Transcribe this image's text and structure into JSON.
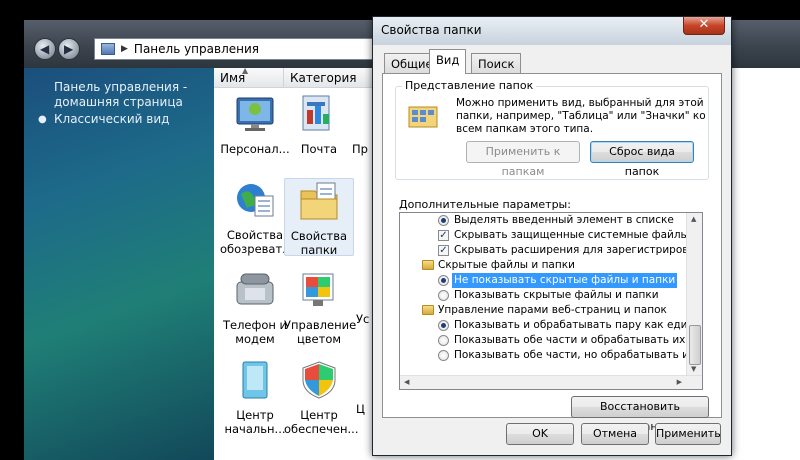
{
  "explorer": {
    "address": "Панель управления",
    "left_pane": {
      "home_link": "Панель управления - домашняя страница",
      "classic_link": "Классический вид"
    },
    "columns": [
      "Имя",
      "Категория"
    ],
    "items": [
      {
        "label": "Персонал...",
        "icon": "personalization-icon"
      },
      {
        "label": "Почта",
        "icon": "mail-icon"
      },
      {
        "label": "Пр",
        "icon": "partial-icon"
      },
      {
        "label": "Свойства обозреват...",
        "icon": "internet-options-icon"
      },
      {
        "label": "Свойства папки",
        "icon": "folder-options-icon"
      },
      {
        "label": "Телефон и модем",
        "icon": "phone-modem-icon"
      },
      {
        "label": "Управление цветом",
        "icon": "color-management-icon"
      },
      {
        "label": "Ус",
        "icon": "partial-icon"
      },
      {
        "label": "Центр начальн...",
        "icon": "welcome-center-icon"
      },
      {
        "label": "Центр обеспечен...",
        "icon": "security-center-icon"
      },
      {
        "label": "Ц",
        "icon": "partial-icon"
      }
    ]
  },
  "dialog": {
    "title": "Свойства папки",
    "close_label": "✕",
    "tabs": [
      "Общие",
      "Вид",
      "Поиск"
    ],
    "active_tab": "Вид",
    "folder_views": {
      "label": "Представление папок",
      "description": "Можно применить вид, выбранный для этой папки, например, \"Таблица\" или \"Значки\" ко всем папкам этого типа.",
      "apply_button": "Применить к папкам",
      "reset_button": "Сброс вида папок"
    },
    "advanced_label": "Дополнительные параметры:",
    "advanced_items": [
      {
        "type": "radio",
        "checked": true,
        "label": "Выделять введенный элемент в списке",
        "level": 1
      },
      {
        "type": "check",
        "checked": true,
        "label": "Скрывать защищенные системные файлы (рекомен",
        "level": 1
      },
      {
        "type": "check",
        "checked": true,
        "label": "Скрывать расширения для зарегистрированных типо",
        "level": 1
      },
      {
        "type": "folder",
        "label": "Скрытые файлы и папки",
        "level": 0
      },
      {
        "type": "radio",
        "checked": true,
        "label": "Не показывать скрытые файлы и папки",
        "level": 1,
        "selected": true
      },
      {
        "type": "radio",
        "checked": false,
        "label": "Показывать скрытые файлы и папки",
        "level": 1
      },
      {
        "type": "folder",
        "label": "Управление парами веб-страниц и папок",
        "level": 0
      },
      {
        "type": "radio",
        "checked": true,
        "label": "Показывать и обрабатывать пару как единый ф",
        "level": 1
      },
      {
        "type": "radio",
        "checked": false,
        "label": "Показывать обе части и обрабатывать их отдель",
        "level": 1
      },
      {
        "type": "radio",
        "checked": false,
        "label": "Показывать обе части, но обрабатывать их как е",
        "level": 1
      }
    ],
    "restore_button": "Восстановить умолчания",
    "ok_button": "OK",
    "cancel_button": "Отмена",
    "apply_button": "Применить"
  }
}
